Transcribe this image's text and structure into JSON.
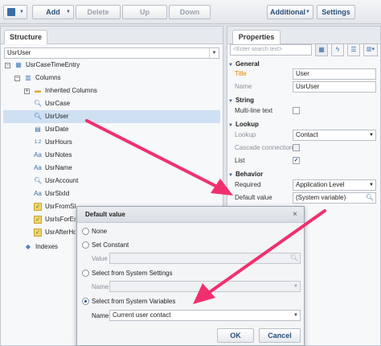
{
  "toolbar": {
    "add": "Add",
    "delete": "Delete",
    "up": "Up",
    "down": "Down",
    "additional": "Additional",
    "settings": "Settings"
  },
  "structure": {
    "tab": "Structure",
    "selector": "UsrUser",
    "root": "UsrCaseTimeEntry",
    "columns": "Columns",
    "inherited": "Inherited Columns",
    "items": [
      "UsrCase",
      "UsrUser",
      "UsrDate",
      "UsrHours",
      "UsrNotes",
      "UsrName",
      "UsrAccount",
      "UsrSlxId",
      "UsrFromSl",
      "UsrIsForEs",
      "UsrAfterHo"
    ],
    "indexes": "Indexes"
  },
  "properties": {
    "tab": "Properties",
    "search_placeholder": "<Enter search text>",
    "general": "General",
    "title_label": "Title",
    "title_value": "User",
    "name_label": "Name",
    "name_value": "UsrUser",
    "string": "String",
    "multiline": "Multi-line text",
    "lookup": "Lookup",
    "lookup_label": "Lookup",
    "lookup_value": "Contact",
    "cascade": "Cascade connection",
    "list": "List",
    "behavior": "Behavior",
    "required_label": "Required",
    "required_value": "Application Level",
    "default_label": "Default value",
    "default_value": "(System variable)"
  },
  "dialog": {
    "title": "Default value",
    "none": "None",
    "set_constant": "Set Constant",
    "value_label": "Value",
    "system_settings": "Select from System Settings",
    "name_label": "Name",
    "system_variables": "Select from System Variables",
    "name_label2": "Name",
    "name_value": "Current user contact",
    "ok": "OK",
    "cancel": "Cancel"
  },
  "colors": {
    "arrow": "#f0306e",
    "accent": "#2a4f7a",
    "selection": "#cfe0f3"
  }
}
